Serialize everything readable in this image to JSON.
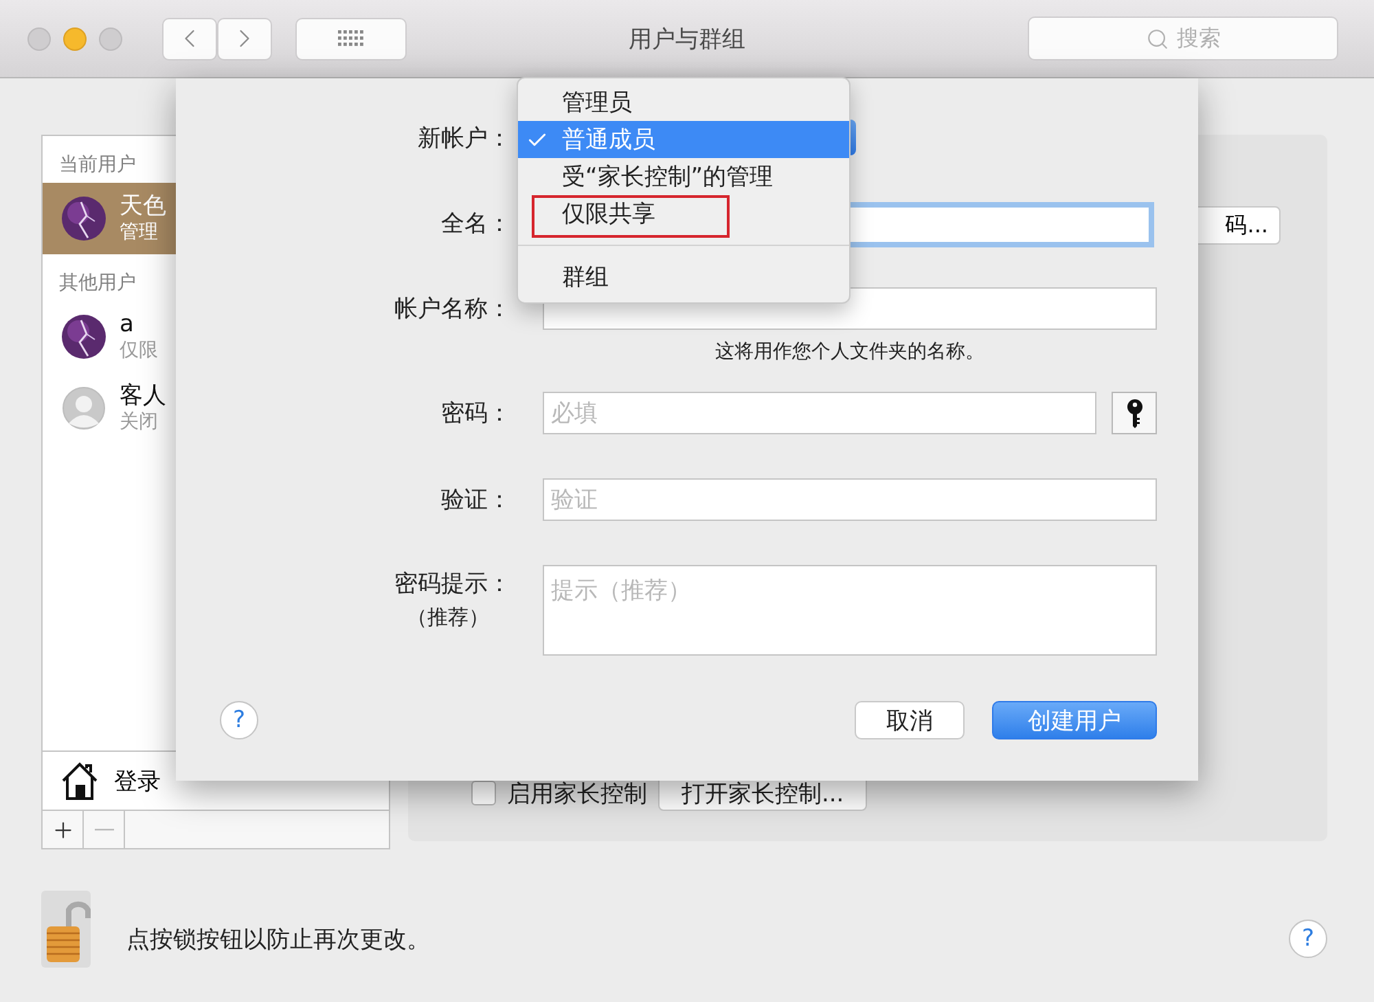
{
  "window": {
    "title": "用户与群组",
    "search": {
      "placeholder": "搜索"
    }
  },
  "sidebar": {
    "sections": [
      {
        "heading": "当前用户",
        "users": [
          {
            "name": "天色",
            "role": "管理",
            "selected": true,
            "kind": "picture"
          }
        ]
      },
      {
        "heading": "其他用户",
        "users": [
          {
            "name": "a",
            "role": "仅限",
            "selected": false,
            "kind": "picture"
          },
          {
            "name": "客人",
            "role": "关闭",
            "selected": false,
            "kind": "silhouette"
          }
        ]
      }
    ],
    "login_options": "登录"
  },
  "panel": {
    "change_button": "码...",
    "parental_control": {
      "label": "启用家长控制",
      "checked": false
    },
    "open_parental_button": "打开家长控制..."
  },
  "lock": {
    "message": "点按锁按钮以防止再次更改。",
    "help": "?"
  },
  "sheet": {
    "fields": [
      {
        "label": "新帐户：",
        "kind": "popup"
      },
      {
        "label": "全名：",
        "kind": "text",
        "focused": true
      },
      {
        "label": "帐户名称：",
        "kind": "text",
        "focused": false,
        "note": "这将用作您个人文件夹的名称。"
      },
      {
        "label": "密码：",
        "kind": "password",
        "placeholder": "必填",
        "focused": false
      },
      {
        "label": "验证：",
        "kind": "text",
        "placeholder": "验证",
        "focused": false
      },
      {
        "label": "密码提示：",
        "sublabel": "（推荐）",
        "kind": "textarea",
        "placeholder": "提示（推荐）",
        "focused": false
      }
    ],
    "help": "?",
    "buttons": [
      {
        "label": "取消",
        "default": false
      },
      {
        "label": "创建用户",
        "default": true
      }
    ]
  },
  "menu": {
    "items": [
      {
        "kind": "item",
        "label": "管理员",
        "selected": false,
        "annotated": false
      },
      {
        "kind": "item",
        "label": "普通成员",
        "selected": true,
        "annotated": false
      },
      {
        "kind": "item",
        "label": "受“家长控制”的管理",
        "selected": false,
        "annotated": false
      },
      {
        "kind": "item",
        "label": "仅限共享",
        "selected": false,
        "annotated": true
      },
      {
        "kind": "separator"
      },
      {
        "kind": "item",
        "label": "群组",
        "selected": false,
        "annotated": false
      }
    ]
  }
}
